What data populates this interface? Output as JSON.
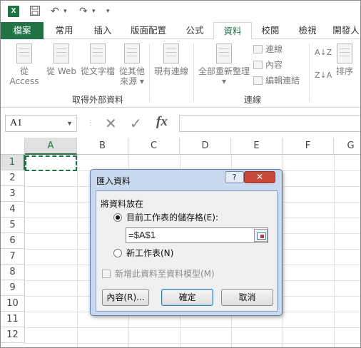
{
  "qat": {
    "app_icon": "X",
    "undo_icon": "↶",
    "redo_icon": "↷",
    "more_icon": "▾"
  },
  "tabs": [
    "檔案",
    "常用",
    "插入",
    "版面配置",
    "公式",
    "資料",
    "校閱",
    "檢視",
    "開發人"
  ],
  "active_tab": "資料",
  "ribbon": {
    "buttons": [
      {
        "label": "從 Access"
      },
      {
        "label": "從 Web"
      },
      {
        "label": "從文字檔"
      },
      {
        "label": "從其他",
        "label2": "來源 ▾"
      },
      {
        "label": "現有連線"
      },
      {
        "label": "全部重新整理",
        "label2": "▾"
      }
    ],
    "small": [
      "連線",
      "內容",
      "編輯連結"
    ],
    "sort_az": "A↓Z",
    "sort_za": "Z↓A",
    "sort_label": "排序",
    "groups": [
      "取得外部資料",
      "連線"
    ]
  },
  "formula_bar": {
    "name_box": "A1",
    "cancel": "✕",
    "enter": "✓",
    "fx": "fx",
    "formula": ""
  },
  "columns": [
    "A",
    "B",
    "C",
    "D",
    "E",
    "F",
    "G"
  ],
  "rows": [
    "1",
    "2",
    "3",
    "4",
    "5",
    "6",
    "7",
    "8",
    "9",
    "10",
    "11",
    "12"
  ],
  "dialog": {
    "title": "匯入資料",
    "help": "?",
    "close": "✕",
    "place_label": "將資料放在",
    "option_existing": "目前工作表的儲存格(E):",
    "range_value": "=$A$1",
    "option_new": "新工作表(N)",
    "add_model": "新增此資料至資料模型(M)",
    "properties": "內容(R)...",
    "ok": "確定",
    "cancel": "取消"
  },
  "colors": {
    "excel_green": "#217346",
    "dialog_frame": "#c9daf0",
    "close_red": "#c8483a"
  }
}
